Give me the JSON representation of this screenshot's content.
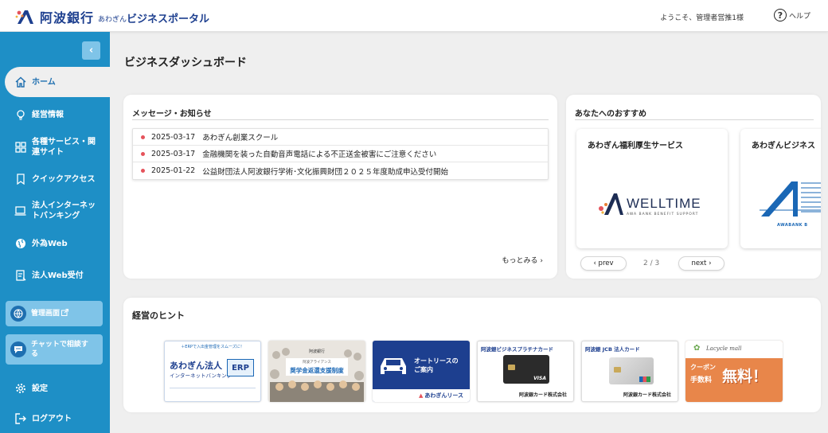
{
  "header": {
    "bank_name": "阿波銀行",
    "portal_prefix": "あわぎん",
    "portal_name": "ビジネスポータル",
    "welcome_text": "ようこそ、管理者営推1様",
    "help_label": "ヘルプ"
  },
  "sidebar": {
    "collapse_label": "‹",
    "items": [
      {
        "label": "ホーム",
        "icon": "home-icon"
      },
      {
        "label": "経営情報",
        "icon": "lightbulb-icon"
      },
      {
        "label": "各種サービス・関連サイト",
        "icon": "grid-icon"
      },
      {
        "label": "クイックアクセス",
        "icon": "bookmark-icon"
      },
      {
        "label": "法人インターネットバンキング",
        "icon": "laptop-icon"
      },
      {
        "label": "外為Web",
        "icon": "globe-icon"
      },
      {
        "label": "法人Web受付",
        "icon": "form-icon"
      }
    ],
    "external": [
      {
        "label": "管理画面",
        "icon": "globe-icon"
      },
      {
        "label": "チャットで相談する",
        "icon": "chat-icon"
      }
    ],
    "settings_label": "設定",
    "logout_label": "ログアウト"
  },
  "main": {
    "page_title": "ビジネスダッシュボード",
    "messages": {
      "title": "メッセージ・お知らせ",
      "items": [
        {
          "date": "2025-03-17",
          "text": "あわぎん創業スクール"
        },
        {
          "date": "2025-03-17",
          "text": "金融機関を装った自動音声電話による不正送金被害にご注意ください"
        },
        {
          "date": "2025-01-22",
          "text": "公益財団法人阿波銀行学術･文化振興財団２０２５年度助成申込受付開始"
        }
      ],
      "more_label": "もっとみる ›"
    },
    "recommend": {
      "title": "あなたへのおすすめ",
      "cards": [
        {
          "title": "あわぎん福利厚生サービス",
          "logo_text": "WELLTIME",
          "logo_sub": "AWA BANK BENEFIT SUPPORT"
        },
        {
          "title": "あわぎんビジネス",
          "logo_text": "AWABANK B"
        }
      ],
      "prev_label": "‹  prev",
      "next_label": "next  ›",
      "page_indicator": "2 / 3"
    },
    "tips": {
      "title": "経営のヒント",
      "banners": [
        {
          "top": "＋ERPで入出金管理をスムーズに！",
          "main": "あわぎん法人",
          "sub": "インターネットバンキング",
          "badge": "ERP"
        },
        {
          "top": "阿波銀行",
          "main": "奨学金返還支援制度",
          "sub": "阿波アライアンス"
        },
        {
          "main": "オートリースの",
          "main2": "ご案内",
          "footer": "あわぎんリース"
        },
        {
          "title": "阿波銀ビジネスプラチナカード",
          "footer": "阿波銀カード株式会社",
          "brand": "VISA"
        },
        {
          "title": "阿波銀 JCB 法人カード",
          "footer": "阿波銀カード株式会社"
        },
        {
          "top": "Lacycle mall",
          "main": "クーポン",
          "main2": "手数料",
          "big": "無料！"
        }
      ]
    }
  },
  "colors": {
    "sidebar": "#1e8fc6",
    "brand_navy": "#1d3f8f",
    "accent_red": "#e5535b"
  }
}
